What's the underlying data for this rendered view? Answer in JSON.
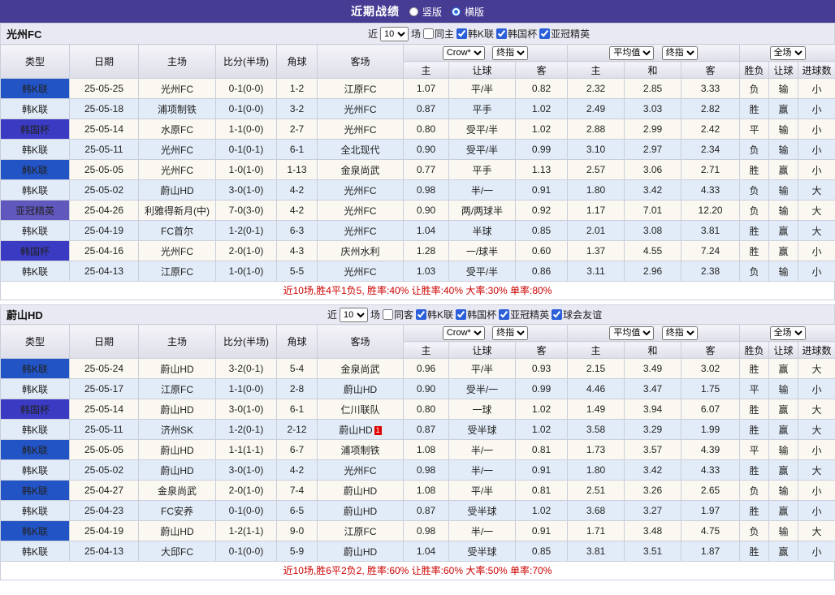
{
  "top_bar": {
    "title": "近期战绩",
    "radios": {
      "vertical": "竖版",
      "horizontal": "横版"
    }
  },
  "table_header": {
    "type": "类型",
    "date": "日期",
    "home": "主场",
    "score": "比分(半场)",
    "corner": "角球",
    "away": "客场",
    "odds_source": "Crow*",
    "odds_stage": "终指",
    "avg_source": "平均值",
    "avg_stage": "终指",
    "scope": "全场",
    "home_odds": "主",
    "handicap": "让球",
    "away_odds": "客",
    "avg_home": "主",
    "avg_draw": "和",
    "avg_away": "客",
    "wdl": "胜负",
    "handicap_result": "让球",
    "goals": "进球数"
  },
  "colors": {
    "top_bar_bg": "#463C94",
    "league_kleague": "#2254C5",
    "league_korea_cup": "#3A3AC2",
    "league_acl_elite": "#6158BE",
    "focus_team_green": "#008800",
    "score_red": "#DD2222",
    "result_red": "#DD0000",
    "result_blue": "#0000CC",
    "row_odd_bg": "#FBF8F1",
    "row_even_bg": "#E2ECF8"
  },
  "sections": [
    {
      "team": "光州FC",
      "filter": {
        "near_label": "近",
        "count": "10",
        "games_label": "场",
        "same": {
          "label": "同主",
          "checked": false
        },
        "leagues": [
          {
            "label": "韩K联",
            "checked": true
          },
          {
            "label": "韩国杯",
            "checked": true
          },
          {
            "label": "亚冠精英",
            "checked": true
          }
        ]
      },
      "rows": [
        {
          "league": "韩K联",
          "lc": "k",
          "date": "25-05-25",
          "home": "光州FC",
          "hg": true,
          "score": "0-1(0-0)",
          "corner": "1-2",
          "away": "江原FC",
          "ag": false,
          "o1": "1.07",
          "h": "平/半",
          "o2": "0.82",
          "a1": "2.32",
          "a2": "2.85",
          "a3": "3.33",
          "r1": "负",
          "c1": "b",
          "r2": "输",
          "c2": "b",
          "r3": "小",
          "c3": "b"
        },
        {
          "league": "韩K联",
          "lc": "k",
          "date": "25-05-18",
          "home": "浦项制铁",
          "hg": false,
          "score": "0-1(0-0)",
          "corner": "3-2",
          "away": "光州FC",
          "ag": true,
          "o1": "0.87",
          "h": "平手",
          "o2": "1.02",
          "a1": "2.49",
          "a2": "3.03",
          "a3": "2.82",
          "r1": "胜",
          "c1": "r",
          "r2": "赢",
          "c2": "r",
          "r3": "小",
          "c3": "b"
        },
        {
          "league": "韩国杯",
          "lc": "c",
          "date": "25-05-14",
          "home": "水原FC",
          "hg": false,
          "score": "1-1(0-0)",
          "corner": "2-7",
          "away": "光州FC",
          "ag": true,
          "o1": "0.80",
          "h": "受平/半",
          "o2": "1.02",
          "a1": "2.88",
          "a2": "2.99",
          "a3": "2.42",
          "r1": "平",
          "c1": "b",
          "r2": "输",
          "c2": "b",
          "r3": "小",
          "c3": "b"
        },
        {
          "league": "韩K联",
          "lc": "k",
          "date": "25-05-11",
          "home": "光州FC",
          "hg": true,
          "score": "0-1(0-1)",
          "corner": "6-1",
          "away": "全北现代",
          "ag": false,
          "o1": "0.90",
          "h": "受平/半",
          "o2": "0.99",
          "a1": "3.10",
          "a2": "2.97",
          "a3": "2.34",
          "r1": "负",
          "c1": "b",
          "r2": "输",
          "c2": "b",
          "r3": "小",
          "c3": "b"
        },
        {
          "league": "韩K联",
          "lc": "k",
          "date": "25-05-05",
          "home": "光州FC",
          "hg": true,
          "score": "1-0(1-0)",
          "corner": "1-13",
          "away": "金泉尚武",
          "ag": false,
          "o1": "0.77",
          "h": "平手",
          "o2": "1.13",
          "a1": "2.57",
          "a2": "3.06",
          "a3": "2.71",
          "r1": "胜",
          "c1": "r",
          "r2": "赢",
          "c2": "r",
          "r3": "小",
          "c3": "b"
        },
        {
          "league": "韩K联",
          "lc": "k",
          "date": "25-05-02",
          "home": "蔚山HD",
          "hg": false,
          "score": "3-0(1-0)",
          "corner": "4-2",
          "away": "光州FC",
          "ag": true,
          "o1": "0.98",
          "h": "半/一",
          "o2": "0.91",
          "a1": "1.80",
          "a2": "3.42",
          "a3": "4.33",
          "r1": "负",
          "c1": "b",
          "r2": "输",
          "c2": "b",
          "r3": "大",
          "c3": "r"
        },
        {
          "league": "亚冠精英",
          "lc": "a",
          "date": "25-04-26",
          "home": "利雅得新月(中)",
          "hg": false,
          "score": "7-0(3-0)",
          "corner": "4-2",
          "away": "光州FC",
          "ag": true,
          "o1": "0.90",
          "h": "两/两球半",
          "o2": "0.92",
          "a1": "1.17",
          "a2": "7.01",
          "a3": "12.20",
          "r1": "负",
          "c1": "b",
          "r2": "输",
          "c2": "b",
          "r3": "大",
          "c3": "r"
        },
        {
          "league": "韩K联",
          "lc": "k",
          "date": "25-04-19",
          "home": "FC首尔",
          "hg": false,
          "score": "1-2(0-1)",
          "corner": "6-3",
          "away": "光州FC",
          "ag": true,
          "o1": "1.04",
          "h": "半球",
          "o2": "0.85",
          "a1": "2.01",
          "a2": "3.08",
          "a3": "3.81",
          "r1": "胜",
          "c1": "r",
          "r2": "赢",
          "c2": "r",
          "r3": "大",
          "c3": "r"
        },
        {
          "league": "韩国杯",
          "lc": "c",
          "date": "25-04-16",
          "home": "光州FC",
          "hg": true,
          "score": "2-0(1-0)",
          "corner": "4-3",
          "away": "庆州水利",
          "ag": false,
          "o1": "1.28",
          "h": "一/球半",
          "o2": "0.60",
          "a1": "1.37",
          "a2": "4.55",
          "a3": "7.24",
          "r1": "胜",
          "c1": "r",
          "r2": "赢",
          "c2": "r",
          "r3": "小",
          "c3": "b"
        },
        {
          "league": "韩K联",
          "lc": "k",
          "date": "25-04-13",
          "home": "江原FC",
          "hg": false,
          "score": "1-0(1-0)",
          "corner": "5-5",
          "away": "光州FC",
          "ag": true,
          "o1": "1.03",
          "h": "受平/半",
          "o2": "0.86",
          "a1": "3.11",
          "a2": "2.96",
          "a3": "2.38",
          "r1": "负",
          "c1": "b",
          "r2": "输",
          "c2": "b",
          "r3": "小",
          "c3": "b"
        }
      ],
      "summary": "近10场,胜4平1负5, 胜率:40%  让胜率:40%  大率:30%  单率:80%"
    },
    {
      "team": "蔚山HD",
      "filter": {
        "near_label": "近",
        "count": "10",
        "games_label": "场",
        "same": {
          "label": "同客",
          "checked": false
        },
        "leagues": [
          {
            "label": "韩K联",
            "checked": true
          },
          {
            "label": "韩国杯",
            "checked": true
          },
          {
            "label": "亚冠精英",
            "checked": true
          },
          {
            "label": "球会友谊",
            "checked": true
          }
        ]
      },
      "rows": [
        {
          "league": "韩K联",
          "lc": "k",
          "date": "25-05-24",
          "home": "蔚山HD",
          "hg": true,
          "score": "3-2(0-1)",
          "corner": "5-4",
          "away": "金泉尚武",
          "ag": false,
          "o1": "0.96",
          "h": "平/半",
          "o2": "0.93",
          "a1": "2.15",
          "a2": "3.49",
          "a3": "3.02",
          "r1": "胜",
          "c1": "r",
          "r2": "赢",
          "c2": "r",
          "r3": "大",
          "c3": "r"
        },
        {
          "league": "韩K联",
          "lc": "k",
          "date": "25-05-17",
          "home": "江原FC",
          "hg": false,
          "score": "1-1(0-0)",
          "corner": "2-8",
          "away": "蔚山HD",
          "ag": true,
          "o1": "0.90",
          "h": "受半/一",
          "o2": "0.99",
          "a1": "4.46",
          "a2": "3.47",
          "a3": "1.75",
          "r1": "平",
          "c1": "b",
          "r2": "输",
          "c2": "b",
          "r3": "小",
          "c3": "b"
        },
        {
          "league": "韩国杯",
          "lc": "c",
          "date": "25-05-14",
          "home": "蔚山HD",
          "hg": true,
          "score": "3-0(1-0)",
          "corner": "6-1",
          "away": "仁川联队",
          "ag": false,
          "o1": "0.80",
          "h": "一球",
          "o2": "1.02",
          "a1": "1.49",
          "a2": "3.94",
          "a3": "6.07",
          "r1": "胜",
          "c1": "r",
          "r2": "赢",
          "c2": "r",
          "r3": "大",
          "c3": "r"
        },
        {
          "league": "韩K联",
          "lc": "k",
          "date": "25-05-11",
          "home": "济州SK",
          "hg": false,
          "score": "1-2(0-1)",
          "corner": "2-12",
          "away": "蔚山HD",
          "ag": true,
          "badge": "1",
          "o1": "0.87",
          "h": "受半球",
          "o2": "1.02",
          "a1": "3.58",
          "a2": "3.29",
          "a3": "1.99",
          "r1": "胜",
          "c1": "r",
          "r2": "赢",
          "c2": "r",
          "r3": "大",
          "c3": "r"
        },
        {
          "league": "韩K联",
          "lc": "k",
          "date": "25-05-05",
          "home": "蔚山HD",
          "hg": true,
          "score": "1-1(1-1)",
          "corner": "6-7",
          "away": "浦项制铁",
          "ag": false,
          "o1": "1.08",
          "h": "半/一",
          "o2": "0.81",
          "a1": "1.73",
          "a2": "3.57",
          "a3": "4.39",
          "r1": "平",
          "c1": "b",
          "r2": "输",
          "c2": "b",
          "r3": "小",
          "c3": "b"
        },
        {
          "league": "韩K联",
          "lc": "k",
          "date": "25-05-02",
          "home": "蔚山HD",
          "hg": true,
          "score": "3-0(1-0)",
          "corner": "4-2",
          "away": "光州FC",
          "ag": false,
          "o1": "0.98",
          "h": "半/一",
          "o2": "0.91",
          "a1": "1.80",
          "a2": "3.42",
          "a3": "4.33",
          "r1": "胜",
          "c1": "r",
          "r2": "赢",
          "c2": "r",
          "r3": "大",
          "c3": "r"
        },
        {
          "league": "韩K联",
          "lc": "k",
          "date": "25-04-27",
          "home": "金泉尚武",
          "hg": false,
          "score": "2-0(1-0)",
          "corner": "7-4",
          "away": "蔚山HD",
          "ag": true,
          "o1": "1.08",
          "h": "平/半",
          "o2": "0.81",
          "a1": "2.51",
          "a2": "3.26",
          "a3": "2.65",
          "r1": "负",
          "c1": "b",
          "r2": "输",
          "c2": "b",
          "r3": "小",
          "c3": "b"
        },
        {
          "league": "韩K联",
          "lc": "k",
          "date": "25-04-23",
          "home": "FC安养",
          "hg": false,
          "score": "0-1(0-0)",
          "corner": "6-5",
          "away": "蔚山HD",
          "ag": true,
          "o1": "0.87",
          "h": "受半球",
          "o2": "1.02",
          "a1": "3.68",
          "a2": "3.27",
          "a3": "1.97",
          "r1": "胜",
          "c1": "r",
          "r2": "赢",
          "c2": "r",
          "r3": "小",
          "c3": "b"
        },
        {
          "league": "韩K联",
          "lc": "k",
          "date": "25-04-19",
          "home": "蔚山HD",
          "hg": true,
          "score": "1-2(1-1)",
          "corner": "9-0",
          "away": "江原FC",
          "ag": false,
          "o1": "0.98",
          "h": "半/一",
          "o2": "0.91",
          "a1": "1.71",
          "a2": "3.48",
          "a3": "4.75",
          "r1": "负",
          "c1": "b",
          "r2": "输",
          "c2": "b",
          "r3": "大",
          "c3": "r"
        },
        {
          "league": "韩K联",
          "lc": "k",
          "date": "25-04-13",
          "home": "大邱FC",
          "hg": false,
          "score": "0-1(0-0)",
          "corner": "5-9",
          "away": "蔚山HD",
          "ag": true,
          "o1": "1.04",
          "h": "受半球",
          "o2": "0.85",
          "a1": "3.81",
          "a2": "3.51",
          "a3": "1.87",
          "r1": "胜",
          "c1": "r",
          "r2": "赢",
          "c2": "r",
          "r3": "小",
          "c3": "b"
        }
      ],
      "summary": "近10场,胜6平2负2, 胜率:60%  让胜率:60%  大率:50%  单率:70%"
    }
  ]
}
